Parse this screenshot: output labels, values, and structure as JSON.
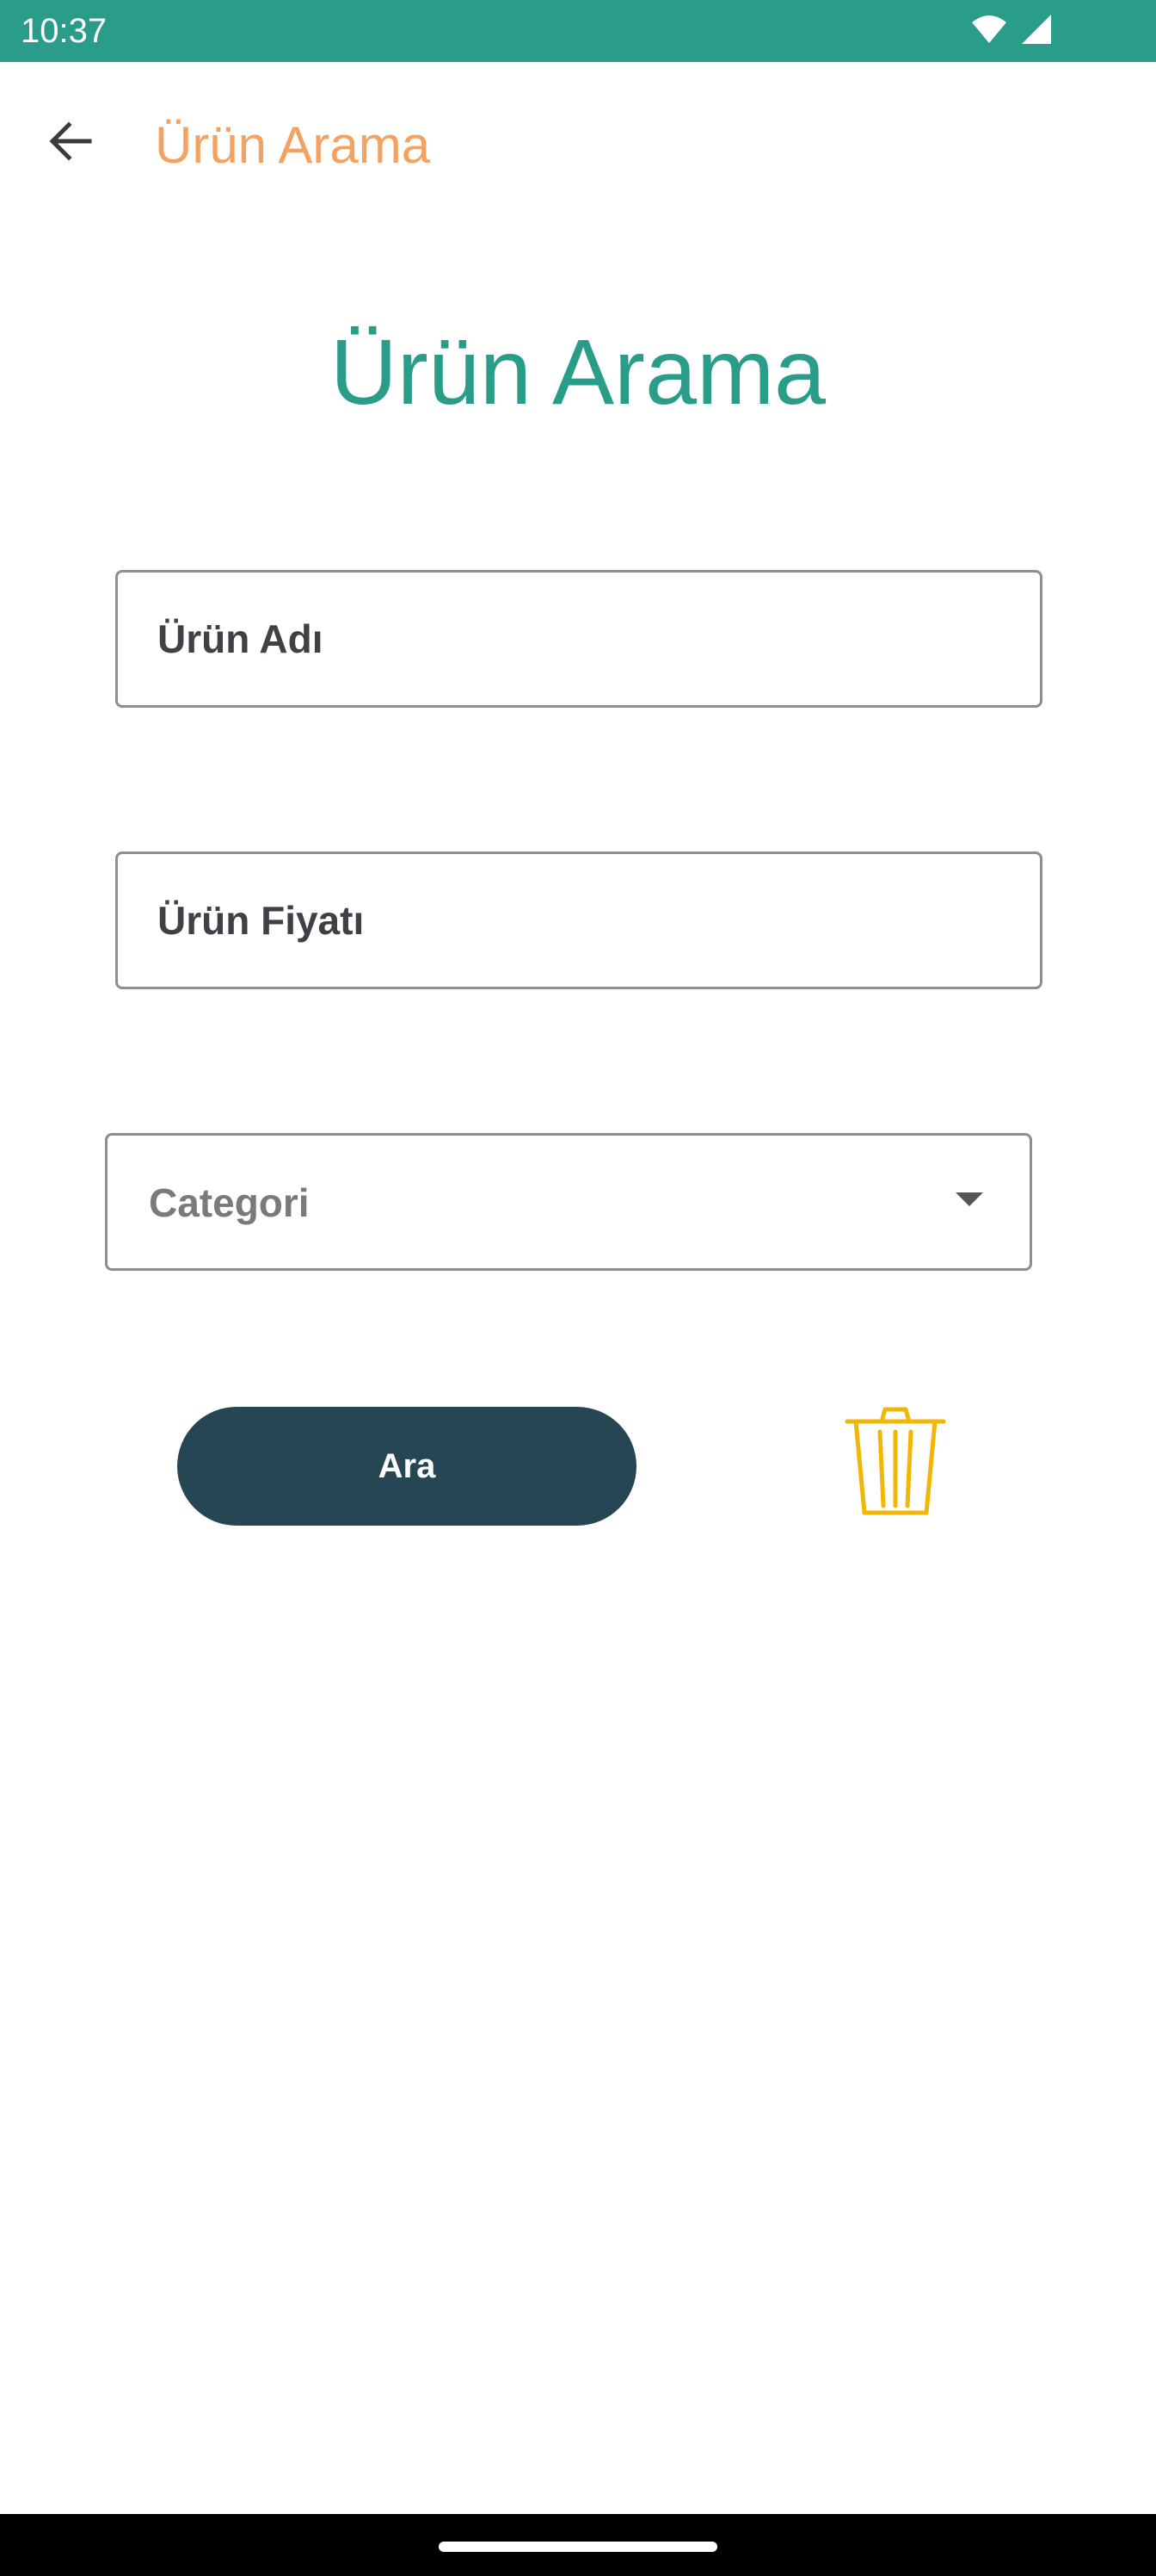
{
  "status_bar": {
    "time": "10:37",
    "icons": [
      "wifi-icon",
      "cellular-signal-icon"
    ]
  },
  "app_bar": {
    "back_icon": "arrow-back-icon",
    "title": "Ürün Arama"
  },
  "page": {
    "heading": "Ürün Arama"
  },
  "form": {
    "product_name": {
      "placeholder": "Ürün Adı",
      "value": ""
    },
    "product_price": {
      "placeholder": "Ürün Fiyatı",
      "value": ""
    },
    "category": {
      "selected": "Categori",
      "icon": "dropdown-arrow-icon"
    }
  },
  "actions": {
    "search_label": "Ara",
    "delete_icon": "trash-icon"
  },
  "colors": {
    "status_bar": "#2a9d8a",
    "app_bar_title": "#f4a261",
    "heading": "#2a9d8a",
    "search_button": "#264653",
    "trash_icon": "#f2b705"
  }
}
